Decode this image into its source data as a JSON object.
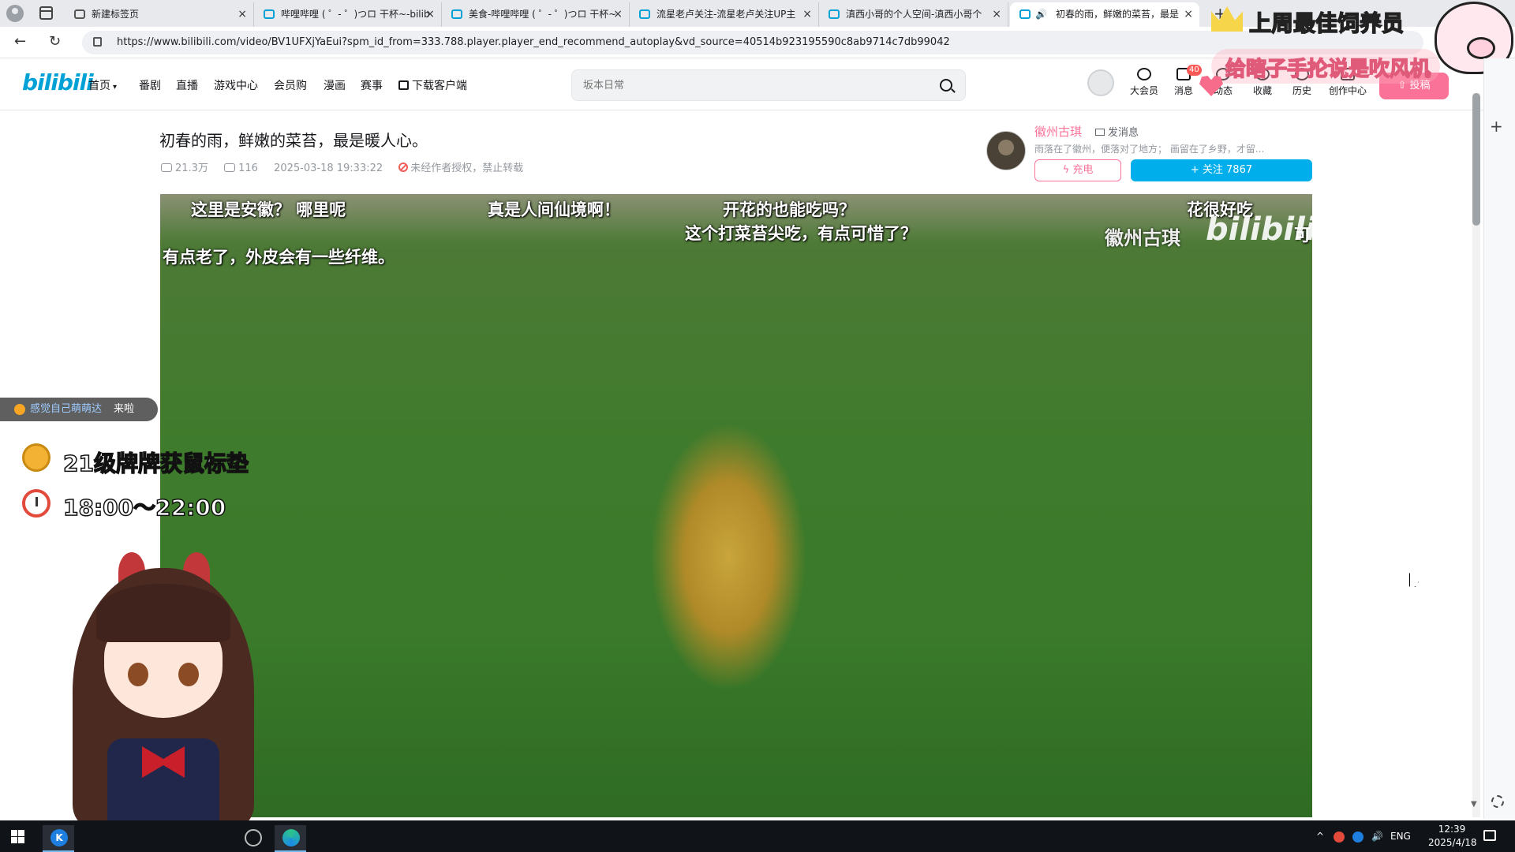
{
  "browser": {
    "tabs": [
      {
        "label": "新建标签页",
        "active": false
      },
      {
        "label": "哔哩哔哩 ( ゜- ゜)つロ 干杯~-bilib",
        "active": false
      },
      {
        "label": "美食-哔哩哔哩 ( ゜- ゜)つロ 干杯~",
        "active": false
      },
      {
        "label": "流星老卢关注-流星老卢关注UP主",
        "active": false
      },
      {
        "label": "滇西小哥的个人空间-滇西小哥个",
        "active": false
      },
      {
        "label": "初春的雨，鲜嫩的菜苔，最是",
        "active": true
      }
    ],
    "close_glyph": "×",
    "speaker_glyph": "🔊",
    "new_tab_glyph": "+",
    "back_glyph": "←",
    "reload_glyph": "↻",
    "url": "https://www.bilibili.com/video/BV1UFXjYaEui?spm_id_from=333.788.player.player_end_recommend_autoplay&vd_source=40514b923195590c8ab9714c7db99042"
  },
  "overlay": {
    "banner": "上周最佳饲养员",
    "marquee": "给瞎子手抡说是吹风机",
    "greeting_user": "感觉自己萌萌达",
    "greeting_text": "来啦",
    "prize": "21级牌牌获鼠标垫",
    "time": "18:00～22:00"
  },
  "bili": {
    "logo": "bilibili",
    "nav": [
      {
        "label": "首页",
        "chevron": "▾"
      },
      {
        "label": "番剧"
      },
      {
        "label": "直播"
      },
      {
        "label": "游戏中心"
      },
      {
        "label": "会员购"
      },
      {
        "label": "漫画"
      },
      {
        "label": "赛事"
      },
      {
        "label": "下载客户端"
      }
    ],
    "search_placeholder": "坂本日常",
    "header_items": [
      {
        "label": "大会员"
      },
      {
        "label": "消息",
        "badge": "40"
      },
      {
        "label": "动态"
      },
      {
        "label": "收藏"
      },
      {
        "label": "历史"
      },
      {
        "label": "创作中心"
      }
    ],
    "upload_label": "投稿"
  },
  "video": {
    "title": "初春的雨，鲜嫩的菜苔，最是暖人心。",
    "views": "21.3万",
    "danmaku": "116",
    "date": "2025-03-18 19:33:22",
    "copyright": "未经作者授权，禁止转载",
    "subtitles": {
      "s1": "这里是安徽？ 哪里呢",
      "s2": "真是人间仙境啊！",
      "s3": "开花的也能吃吗？",
      "s4": "这个打菜苔尖吃，有点可惜了？",
      "s5": "花很好吃",
      "s6": "有点老了，外皮会有一些纤维。",
      "s7": "可"
    },
    "watermark_name": "徽州古琪",
    "watermark_logo": "bilibili"
  },
  "up": {
    "name": "徽州古琪",
    "message": "发消息",
    "desc": "雨落在了徽州，便落对了地方； 画留在了乡野，才留...",
    "charge": "充电",
    "follow": "+ 关注 7867"
  },
  "sidebar": {
    "add_glyph": "+",
    "scroll_down_glyph": "▼"
  },
  "taskbar": {
    "app_k": "K",
    "tray_chevron": "^",
    "lang": "ENG",
    "time": "12:39",
    "date": "2025/4/18"
  }
}
